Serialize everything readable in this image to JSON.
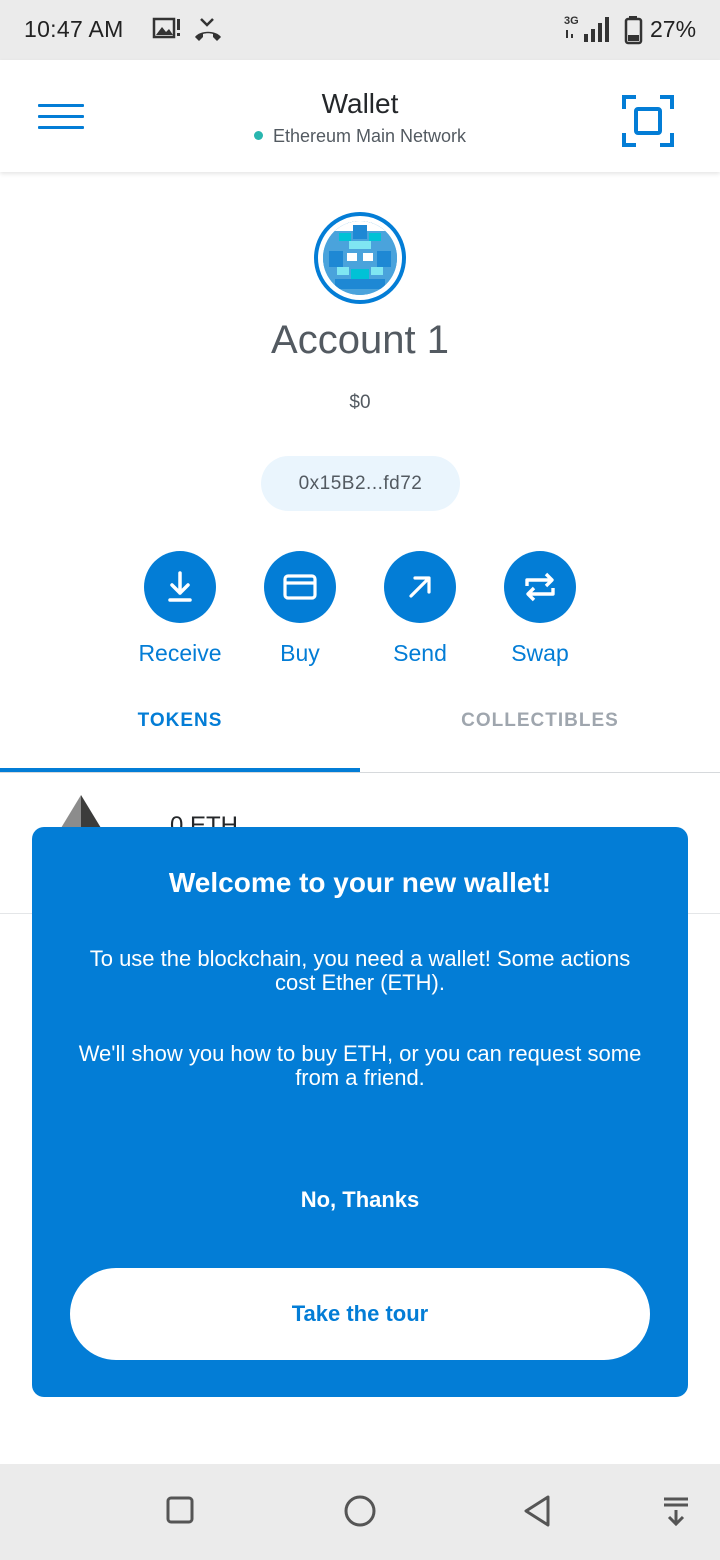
{
  "status_bar": {
    "time": "10:47 AM",
    "network_type": "3G",
    "battery": "27%",
    "icons": [
      "image-notification-icon",
      "missed-call-icon",
      "signal-icon",
      "battery-icon"
    ]
  },
  "header": {
    "title": "Wallet",
    "network": "Ethereum Main Network",
    "network_dot_color": "#29b6af",
    "menu_icon": "hamburger-icon",
    "scan_icon": "qr-scan-icon"
  },
  "account": {
    "name": "Account 1",
    "balance": "$0",
    "address": "0x15B2...fd72"
  },
  "actions": [
    {
      "label": "Receive",
      "icon": "download-icon"
    },
    {
      "label": "Buy",
      "icon": "credit-card-icon"
    },
    {
      "label": "Send",
      "icon": "arrow-up-right-icon"
    },
    {
      "label": "Swap",
      "icon": "swap-arrows-icon"
    }
  ],
  "tabs": [
    {
      "label": "TOKENS",
      "active": true
    },
    {
      "label": "COLLECTIBLES",
      "active": false
    }
  ],
  "token_row": {
    "amount": "0 ETH"
  },
  "modal": {
    "title": "Welcome to your new wallet!",
    "paragraph1": "To use the blockchain, you need a wallet! Some actions cost Ether (ETH).",
    "paragraph2": "We'll show you how to buy ETH, or you can request some from a friend.",
    "decline_label": "No, Thanks",
    "tour_label": "Take the tour"
  },
  "nav_bar": {
    "icons": [
      "recents-square-icon",
      "home-circle-icon",
      "back-triangle-icon",
      "notification-pull-icon"
    ]
  },
  "colors": {
    "accent": "#037dd6",
    "modal_bg": "#037dd6",
    "address_pill_bg": "#eaf5fd",
    "inactive_tab": "#9fa6ae"
  }
}
